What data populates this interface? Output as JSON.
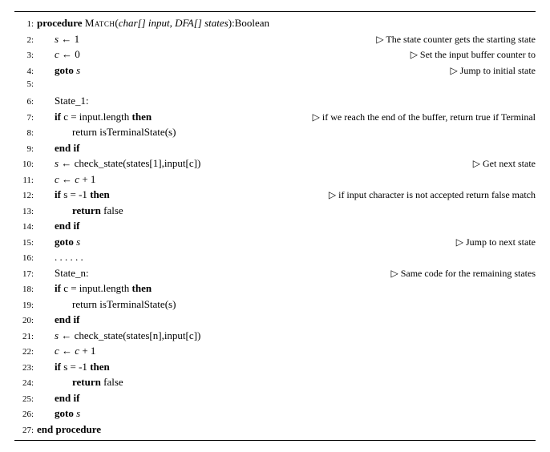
{
  "lines": [
    {
      "n": "1:",
      "indent": 0,
      "parts": [
        {
          "t": "procedure ",
          "c": "kw"
        },
        {
          "t": "Match",
          "c": "sc"
        },
        {
          "t": "("
        },
        {
          "t": "char[] input, DFA[] states",
          "c": "it"
        },
        {
          "t": "):Boolean"
        }
      ],
      "comment": ""
    },
    {
      "n": "2:",
      "indent": 1,
      "parts": [
        {
          "t": "s",
          "c": "it"
        },
        {
          "t": " ← 1"
        }
      ],
      "comment": "▷ The state counter gets the starting state"
    },
    {
      "n": "3:",
      "indent": 1,
      "parts": [
        {
          "t": "c",
          "c": "it"
        },
        {
          "t": " ← 0"
        }
      ],
      "comment": "▷ Set the input buffer counter to"
    },
    {
      "n": "4:",
      "indent": 1,
      "parts": [
        {
          "t": "goto ",
          "c": "kw"
        },
        {
          "t": "s",
          "c": "it"
        }
      ],
      "comment": "▷ Jump to initial state"
    },
    {
      "n": "5:",
      "indent": 1,
      "parts": [],
      "comment": ""
    },
    {
      "n": "6:",
      "indent": 1,
      "parts": [
        {
          "t": "State_1:"
        }
      ],
      "comment": ""
    },
    {
      "n": "7:",
      "indent": 1,
      "parts": [
        {
          "t": "if ",
          "c": "kw"
        },
        {
          "t": "c = input.length "
        },
        {
          "t": "then",
          "c": "kw"
        }
      ],
      "comment": "▷ if we reach the end of the buffer, return true if Terminal"
    },
    {
      "n": "8:",
      "indent": 2,
      "parts": [
        {
          "t": "return isTerminalState(s)"
        }
      ],
      "comment": ""
    },
    {
      "n": "9:",
      "indent": 1,
      "parts": [
        {
          "t": "end if",
          "c": "kw"
        }
      ],
      "comment": ""
    },
    {
      "n": "10:",
      "indent": 1,
      "parts": [
        {
          "t": "s",
          "c": "it"
        },
        {
          "t": " ← check_state(states[1],input[c])"
        }
      ],
      "comment": "▷ Get next state"
    },
    {
      "n": "11:",
      "indent": 1,
      "parts": [
        {
          "t": "c",
          "c": "it"
        },
        {
          "t": " ← "
        },
        {
          "t": "c",
          "c": "it"
        },
        {
          "t": " + 1"
        }
      ],
      "comment": ""
    },
    {
      "n": "12:",
      "indent": 1,
      "parts": [
        {
          "t": "if ",
          "c": "kw"
        },
        {
          "t": "s = -1 "
        },
        {
          "t": "then",
          "c": "kw"
        }
      ],
      "comment": "▷ if input character is not accepted return false match"
    },
    {
      "n": "13:",
      "indent": 2,
      "parts": [
        {
          "t": "return ",
          "c": "kw"
        },
        {
          "t": "false"
        }
      ],
      "comment": ""
    },
    {
      "n": "14:",
      "indent": 1,
      "parts": [
        {
          "t": "end if",
          "c": "kw"
        }
      ],
      "comment": ""
    },
    {
      "n": "15:",
      "indent": 1,
      "parts": [
        {
          "t": "goto ",
          "c": "kw"
        },
        {
          "t": "s",
          "c": "it"
        }
      ],
      "comment": "▷ Jump to next state"
    },
    {
      "n": "16:",
      "indent": 1,
      "parts": [
        {
          "t": ". . . . . ."
        }
      ],
      "comment": ""
    },
    {
      "n": "17:",
      "indent": 1,
      "parts": [
        {
          "t": "State_n:"
        }
      ],
      "comment": "▷ Same code for the remaining states"
    },
    {
      "n": "18:",
      "indent": 1,
      "parts": [
        {
          "t": "if ",
          "c": "kw"
        },
        {
          "t": "c = input.length "
        },
        {
          "t": "then",
          "c": "kw"
        }
      ],
      "comment": ""
    },
    {
      "n": "19:",
      "indent": 2,
      "parts": [
        {
          "t": "return isTerminalState(s)"
        }
      ],
      "comment": ""
    },
    {
      "n": "20:",
      "indent": 1,
      "parts": [
        {
          "t": "end if",
          "c": "kw"
        }
      ],
      "comment": ""
    },
    {
      "n": "21:",
      "indent": 1,
      "parts": [
        {
          "t": "s",
          "c": "it"
        },
        {
          "t": " ← check_state(states[n],input[c])"
        }
      ],
      "comment": ""
    },
    {
      "n": "22:",
      "indent": 1,
      "parts": [
        {
          "t": "c",
          "c": "it"
        },
        {
          "t": " ← "
        },
        {
          "t": "c",
          "c": "it"
        },
        {
          "t": " + 1"
        }
      ],
      "comment": ""
    },
    {
      "n": "23:",
      "indent": 1,
      "parts": [
        {
          "t": "if ",
          "c": "kw"
        },
        {
          "t": "s = -1 "
        },
        {
          "t": "then",
          "c": "kw"
        }
      ],
      "comment": ""
    },
    {
      "n": "24:",
      "indent": 2,
      "parts": [
        {
          "t": "return ",
          "c": "kw"
        },
        {
          "t": "false"
        }
      ],
      "comment": ""
    },
    {
      "n": "25:",
      "indent": 1,
      "parts": [
        {
          "t": "end if",
          "c": "kw"
        }
      ],
      "comment": ""
    },
    {
      "n": "26:",
      "indent": 1,
      "parts": [
        {
          "t": "goto ",
          "c": "kw"
        },
        {
          "t": "s",
          "c": "it"
        }
      ],
      "comment": ""
    },
    {
      "n": "27:",
      "indent": 0,
      "parts": [
        {
          "t": "end procedure",
          "c": "kw"
        }
      ],
      "comment": ""
    }
  ]
}
